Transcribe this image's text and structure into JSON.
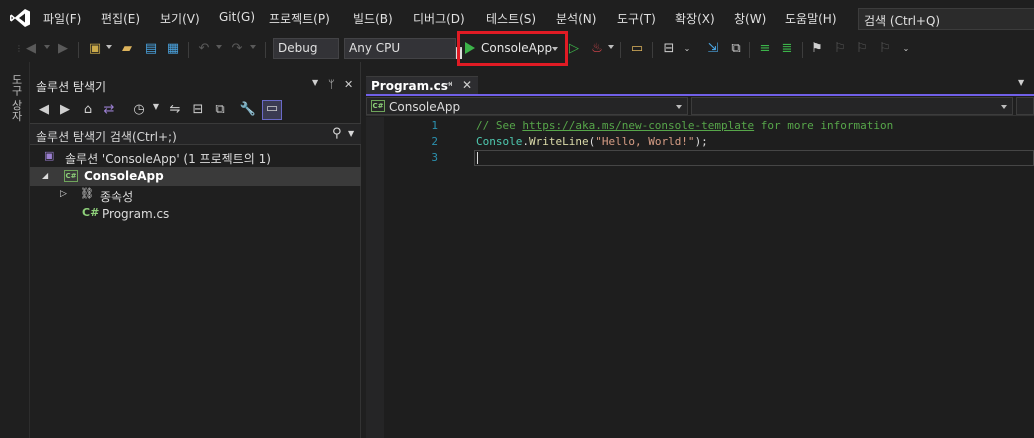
{
  "menu": {
    "items": [
      "파일(F)",
      "편집(E)",
      "보기(V)",
      "Git(G)",
      "프로젝트(P)",
      "빌드(B)",
      "디버그(D)",
      "테스트(S)",
      "분석(N)",
      "도구(T)",
      "확장(X)",
      "창(W)",
      "도움말(H)"
    ],
    "search": "검색 (Ctrl+Q)"
  },
  "toolbar": {
    "config": "Debug",
    "platform": "Any CPU",
    "run_target": "ConsoleApp"
  },
  "toolstrip": {
    "label": "도구 상자"
  },
  "solution_explorer": {
    "title": "솔루션 탐색기",
    "search_placeholder": "솔루션 탐색기 검색(Ctrl+;)",
    "tree": [
      {
        "label": "솔루션 'ConsoleApp' (1 프로젝트의 1)",
        "icon": "solution-icon"
      },
      {
        "label": "ConsoleApp",
        "icon": "csharp-project-icon",
        "selected": true
      },
      {
        "label": "종속성",
        "icon": "dependencies-icon"
      },
      {
        "label": "Program.cs",
        "icon": "csharp-file-icon"
      }
    ]
  },
  "editor": {
    "tab_label": "Program.cs",
    "nav_project": "ConsoleApp",
    "line_numbers": [
      "1",
      "2",
      "3"
    ],
    "code": {
      "line1_comment_prefix": "// See ",
      "line1_link": "https://aka.ms/new-console-template",
      "line1_comment_suffix": " for more information",
      "line2_type": "Console",
      "line2_dot": ".",
      "line2_method": "WriteLine",
      "line2_open": "(",
      "line2_string": "\"Hello, World!\"",
      "line2_close": ");"
    }
  },
  "colors": {
    "highlight_box": "#e01b24",
    "play_green": "#3cb44a",
    "tab_accent": "#7160e8"
  }
}
